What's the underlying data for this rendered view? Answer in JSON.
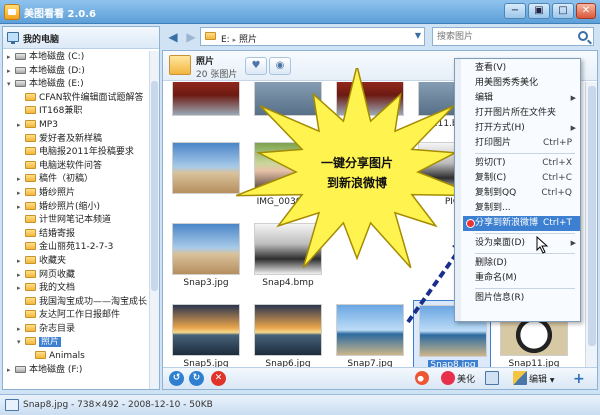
{
  "app": {
    "title": "美图看看 2.0.6"
  },
  "window": {
    "minimize": "−",
    "maximize": "□",
    "restore": "▣",
    "close": "✕"
  },
  "sidebar": {
    "header": "我的电脑",
    "items": [
      {
        "label": "本地磁盘 (C:)",
        "kind": "drive",
        "indent": 0,
        "arrow": "▸"
      },
      {
        "label": "本地磁盘 (D:)",
        "kind": "drive",
        "indent": 0,
        "arrow": "▸"
      },
      {
        "label": "本地磁盘 (E:)",
        "kind": "drive",
        "indent": 0,
        "arrow": "▾"
      },
      {
        "label": "CFAN软件编辑面试题解答",
        "kind": "folder",
        "indent": 1,
        "arrow": ""
      },
      {
        "label": "IT168兼职",
        "kind": "folder",
        "indent": 1,
        "arrow": ""
      },
      {
        "label": "MP3",
        "kind": "folder",
        "indent": 1,
        "arrow": "▸"
      },
      {
        "label": "爱好者及新样稿",
        "kind": "folder",
        "indent": 1,
        "arrow": ""
      },
      {
        "label": "电脑报2011年投稿要求",
        "kind": "folder",
        "indent": 1,
        "arrow": ""
      },
      {
        "label": "电脑迷软件问答",
        "kind": "folder",
        "indent": 1,
        "arrow": ""
      },
      {
        "label": "稿件（初稿）",
        "kind": "folder",
        "indent": 1,
        "arrow": "▸"
      },
      {
        "label": "婚纱照片",
        "kind": "folder",
        "indent": 1,
        "arrow": "▸"
      },
      {
        "label": "婚纱照片(缩小)",
        "kind": "folder",
        "indent": 1,
        "arrow": "▸"
      },
      {
        "label": "计世网笔记本频道",
        "kind": "folder",
        "indent": 1,
        "arrow": ""
      },
      {
        "label": "结婚寄报",
        "kind": "folder",
        "indent": 1,
        "arrow": ""
      },
      {
        "label": "金山丽苑11-2-7-3",
        "kind": "folder",
        "indent": 1,
        "arrow": ""
      },
      {
        "label": "收藏夹",
        "kind": "folder",
        "indent": 1,
        "arrow": "▸"
      },
      {
        "label": "网页收藏",
        "kind": "folder",
        "indent": 1,
        "arrow": "▸"
      },
      {
        "label": "我的文档",
        "kind": "folder",
        "indent": 1,
        "arrow": "▸"
      },
      {
        "label": "我国淘宝成功——淘宝成长",
        "kind": "folder",
        "indent": 1,
        "arrow": ""
      },
      {
        "label": "友达阿工作日报邮件",
        "kind": "folder",
        "indent": 1,
        "arrow": ""
      },
      {
        "label": "杂志目录",
        "kind": "folder",
        "indent": 1,
        "arrow": "▸"
      },
      {
        "label": "照片",
        "kind": "folder",
        "indent": 1,
        "arrow": "▾",
        "selected": true
      },
      {
        "label": "Animals",
        "kind": "folder",
        "indent": 2,
        "arrow": ""
      },
      {
        "label": "本地磁盘 (F:)",
        "kind": "drive",
        "indent": 0,
        "arrow": "▸"
      }
    ]
  },
  "toolbar": {
    "back": "◀",
    "forward": "▶",
    "path_drive": "E:",
    "path_sep": "▸",
    "path_folder": "照片",
    "path_dropdown": "▼",
    "search_placeholder": "搜索图片"
  },
  "folder": {
    "name": "照片",
    "count": "20 张图片",
    "heart": "♥",
    "eye": "◉"
  },
  "thumbnails": [
    {
      "caption": "",
      "style": "red"
    },
    {
      "caption": "",
      "style": "misc"
    },
    {
      "caption": "",
      "style": "red"
    },
    {
      "caption": "111.bmp",
      "style": "misc"
    },
    {
      "caption": "",
      "style": "bw"
    },
    {
      "caption": "",
      "style": "beach"
    },
    {
      "caption": "IMG_0030.JPG",
      "style": "portrait"
    },
    {
      "caption": "PIC",
      "style": "bw"
    },
    {
      "caption": "",
      "style": "panda"
    },
    {
      "caption": "Snap3.jpg",
      "style": "beach"
    },
    {
      "caption": "Snap4.bmp",
      "style": "bw"
    },
    {
      "caption": "",
      "style": "sea"
    },
    {
      "caption": "Snap5.jpg",
      "style": "sunset"
    },
    {
      "caption": "Snap6.jpg",
      "style": "sunset"
    },
    {
      "caption": "Snap7.jpg",
      "style": "sea"
    },
    {
      "caption": "Snap8.jpg",
      "style": "sea",
      "selected": true
    },
    {
      "caption": "Snap11.jpg",
      "style": "panda"
    }
  ],
  "bottombar": {
    "rotate_left": "↺",
    "rotate_right": "↻",
    "delete": "✕",
    "beautify": "美化",
    "edit": "编辑",
    "add": "+"
  },
  "context_menu": [
    {
      "label": "查看(V)",
      "shortcut": "",
      "submenu": false
    },
    {
      "label": "用美图秀秀美化",
      "shortcut": "",
      "submenu": false
    },
    {
      "label": "编辑",
      "shortcut": "",
      "submenu": true
    },
    {
      "label": "打开图片所在文件夹",
      "shortcut": "",
      "submenu": false
    },
    {
      "label": "打开方式(H)",
      "shortcut": "",
      "submenu": true
    },
    {
      "label": "打印图片",
      "shortcut": "Ctrl+P",
      "submenu": false
    },
    {
      "sep": true
    },
    {
      "label": "剪切(T)",
      "shortcut": "Ctrl+X",
      "submenu": false
    },
    {
      "label": "复制(C)",
      "shortcut": "Ctrl+C",
      "submenu": false
    },
    {
      "label": "复制到QQ",
      "shortcut": "Ctrl+Q",
      "submenu": false
    },
    {
      "label": "复制到...",
      "shortcut": "",
      "submenu": false
    },
    {
      "label": "分享到新浪微博",
      "shortcut": "Ctrl+T",
      "submenu": false,
      "active": true
    },
    {
      "sep": true
    },
    {
      "label": "设为桌面(D)",
      "shortcut": "",
      "submenu": true
    },
    {
      "sep": true
    },
    {
      "label": "删除(D)",
      "shortcut": "",
      "submenu": false
    },
    {
      "label": "重命名(M)",
      "shortcut": "",
      "submenu": false
    },
    {
      "sep": true
    },
    {
      "label": "图片信息(R)",
      "shortcut": "",
      "submenu": false
    }
  ],
  "callout": {
    "line1": "一键分享图片",
    "line2": "到新浪微博"
  },
  "status": {
    "text": "Snap8.jpg - 738×492 - 2008-12-10 - 50KB"
  },
  "colors": {
    "accent": "#3d7fd0",
    "star_fill": "#fff34f",
    "star_stroke": "#a58b00",
    "arrow": "#1a2f8c"
  }
}
